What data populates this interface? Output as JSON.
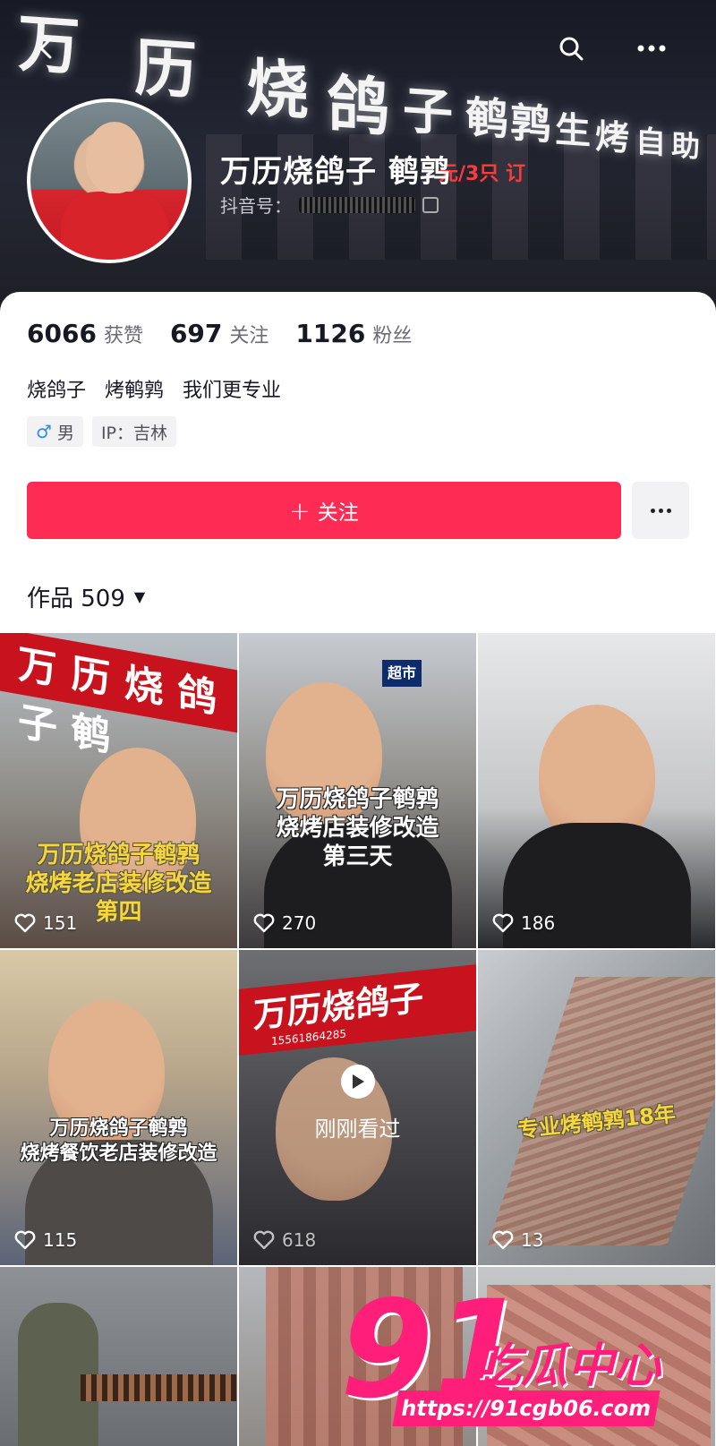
{
  "cover": {
    "sign_chars": [
      "万",
      "历",
      "烧",
      "鸽",
      "子",
      "鹌",
      "鹑",
      "生",
      "烤",
      "自",
      "助"
    ],
    "led_text": "元/3只 订"
  },
  "profile": {
    "nickname": "万历烧鸽子 鹌鹑",
    "douyin_id_label": "抖音号："
  },
  "stats": [
    {
      "num": "6066",
      "label": "获赞"
    },
    {
      "num": "697",
      "label": "关注"
    },
    {
      "num": "1126",
      "label": "粉丝"
    }
  ],
  "bio": "烧鸽子   烤鹌鹑   我们更专业",
  "tags": {
    "gender_icon": "♂",
    "gender": "男",
    "ip": "IP：吉林"
  },
  "follow_button": {
    "plus": "+",
    "label": "关注"
  },
  "works": {
    "label": "作品 509",
    "caret": "▼"
  },
  "grid": [
    {
      "overlay": "万历烧鸽子鹌鹑\n烧烤老店装修改造\n第四",
      "likes": "151",
      "sign": "万 历 烧 鸽 子 鹌"
    },
    {
      "overlay": "万历烧鸽子鹌鹑\n烧烤店装修改造\n第三天",
      "likes": "270",
      "sign": "超市"
    },
    {
      "overlay": "",
      "likes": "186"
    },
    {
      "overlay": "万历烧鸽子鹌鹑\n烧烤餐饮老店装修改造",
      "likes": "115"
    },
    {
      "overlay": "刚刚看过",
      "likes": "618",
      "sign": "万历烧鸽子",
      "sign_phone": "15561864285"
    },
    {
      "overlay": "专业烤鹌鹑18年",
      "likes": "13"
    },
    {
      "overlay": "",
      "likes": ""
    },
    {
      "overlay": "",
      "likes": ""
    },
    {
      "overlay": "",
      "likes": ""
    }
  ],
  "watermark": {
    "big": "91",
    "cn": "吃瓜中心",
    "url": "https://91cgb06.com"
  },
  "icons": {
    "back": "back-icon",
    "search": "search-icon",
    "more": "more-icon",
    "heart": "heart-icon",
    "play": "play-icon"
  },
  "colors": {
    "follow_red": "#fe2c55",
    "watermark_pink": "#ff1f7a",
    "male_blue": "#2f8cf3"
  }
}
